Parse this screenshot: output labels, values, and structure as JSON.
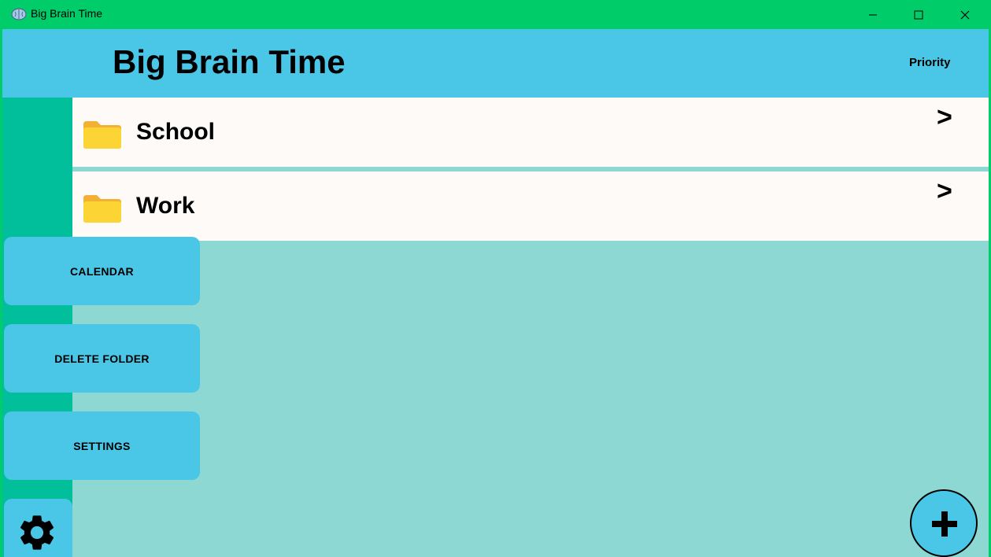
{
  "window": {
    "title": "Big Brain Time",
    "controls": [
      "minimize-icon",
      "maximize-icon",
      "close-icon"
    ]
  },
  "header": {
    "title": "Big Brain Time",
    "priority_label": "Priority"
  },
  "folders": [
    {
      "name": "School",
      "icon": "folder-icon",
      "chevron": ">"
    },
    {
      "name": "Work",
      "icon": "folder-icon",
      "chevron": ">"
    }
  ],
  "sidebar": {
    "buttons": [
      {
        "label": "CALENDAR"
      },
      {
        "label": "DELETE FOLDER"
      },
      {
        "label": "SETTINGS"
      }
    ],
    "gear_icon": "gear-icon"
  },
  "fab": {
    "icon": "plus-icon"
  },
  "colors": {
    "titlebar": "#00cc6a",
    "header": "#4ac6e6",
    "rail": "#00bf9a",
    "content_bg": "#8dd8d2",
    "row_bg": "#fdfaf8"
  }
}
